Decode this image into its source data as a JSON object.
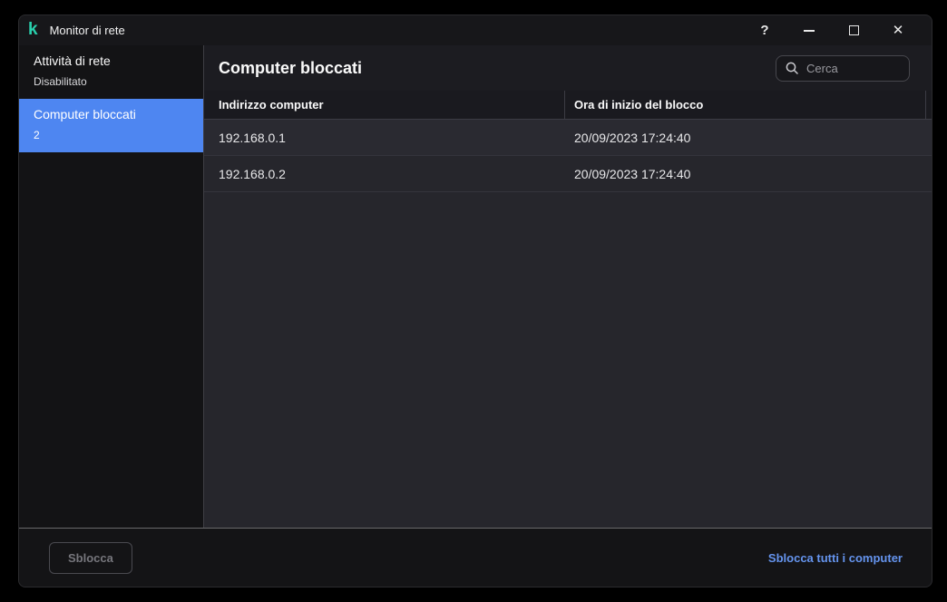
{
  "window": {
    "title": "Monitor di rete",
    "logo_glyph": "k"
  },
  "titlebar": {
    "help_label": "?",
    "close_glyph": "✕"
  },
  "sidebar": {
    "items": [
      {
        "label": "Attività di rete",
        "status": "Disabilitato",
        "selected": false
      },
      {
        "label": "Computer bloccati",
        "status": "2",
        "selected": true
      }
    ]
  },
  "main": {
    "title": "Computer bloccati",
    "search": {
      "placeholder": "Cerca"
    }
  },
  "table": {
    "columns": [
      "Indirizzo computer",
      "Ora di inizio del blocco"
    ],
    "rows": [
      [
        "192.168.0.1",
        "20/09/2023 17:24:40"
      ],
      [
        "192.168.0.2",
        "20/09/2023 17:24:40"
      ]
    ]
  },
  "footer": {
    "unlock_label": "Sblocca",
    "unlock_all_label": "Sblocca tutti i computer"
  },
  "colors": {
    "accent_blue": "#4e86f1",
    "link_blue": "#6594ee",
    "logo_teal": "#29cfad",
    "window_bg": "#26262c",
    "panel_dark": "#131315"
  }
}
